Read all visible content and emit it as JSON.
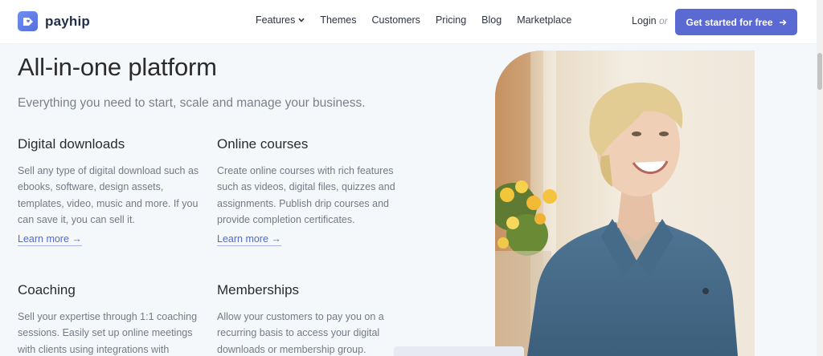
{
  "brand": {
    "name": "payhip"
  },
  "nav": {
    "items": [
      "Features",
      "Themes",
      "Customers",
      "Pricing",
      "Blog",
      "Marketplace"
    ],
    "login": "Login",
    "or": "or",
    "cta": "Get started for free"
  },
  "hero": {
    "title": "All-in-one platform",
    "subtitle": "Everything you need to start, scale and manage your business."
  },
  "features": [
    {
      "title": "Digital downloads",
      "body": "Sell any type of digital download such as ebooks, software, design assets, templates, video, music and more. If you can save it, you can sell it.",
      "link": "Learn more →"
    },
    {
      "title": "Online courses",
      "body": "Create online courses with rich features such as videos, digital files, quizzes and assignments. Publish drip courses and provide completion certificates.",
      "link": "Learn more →"
    },
    {
      "title": "Coaching",
      "body": "Sell your expertise through 1:1 coaching sessions. Easily set up online meetings with clients using integrations with"
    },
    {
      "title": "Memberships",
      "body": "Allow your customers to pay you on a recurring basis to access your digital downloads or membership group."
    }
  ],
  "colors": {
    "accent": "#5b6ad3",
    "link": "#5468c8",
    "background": "#f5f8fb"
  },
  "icons": {
    "logo": "tag-heart-icon",
    "features_chevron": "chevron-down-icon",
    "cta_arrow": "arrow-right-icon"
  }
}
